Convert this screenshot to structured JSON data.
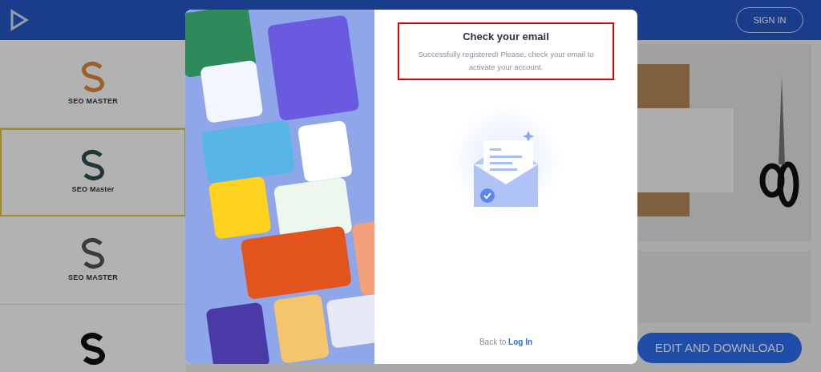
{
  "header": {
    "sign_in": "SIGN IN"
  },
  "logo_cards": [
    {
      "name": "SEO MASTER",
      "selected": false,
      "kind": "outline"
    },
    {
      "name": "SEO Master",
      "selected": true,
      "kind": "serif"
    },
    {
      "name": "SEO MASTER",
      "selected": false,
      "kind": "shaded"
    },
    {
      "selected": false,
      "kind": "bold"
    }
  ],
  "edit_button": "EDIT AND DOWNLOAD",
  "modal": {
    "title": "Check your email",
    "message": "Successfully registered! Please, check your email to activate your account.",
    "back_text": "Back to",
    "back_link": "Log In"
  }
}
